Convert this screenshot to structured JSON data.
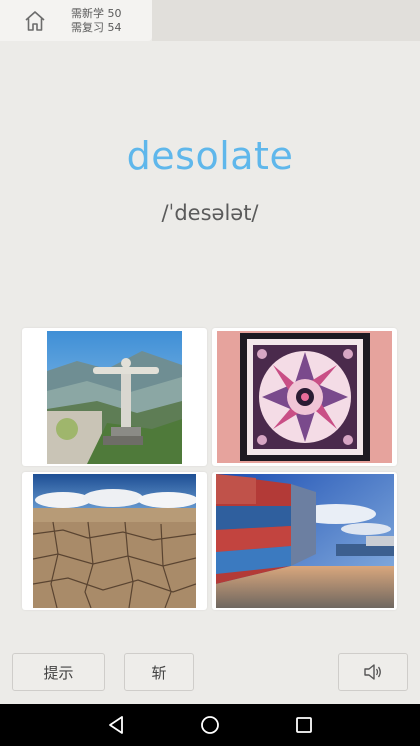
{
  "header": {
    "new_label": "需新学 50",
    "review_label": "需复习 54"
  },
  "word": {
    "text": "desolate",
    "phonetic": "/ˈdesələt/"
  },
  "images": [
    {
      "name": "christ-the-redeemer-image"
    },
    {
      "name": "ornate-scarf-pattern-image"
    },
    {
      "name": "cracked-dry-land-image"
    },
    {
      "name": "shipping-containers-image"
    }
  ],
  "buttons": {
    "hint": "提示",
    "skip": "斩"
  },
  "icons": {
    "home": "home-icon",
    "sound": "speaker-icon",
    "back": "back-triangle-icon",
    "home_nav": "home-circle-icon",
    "recents": "recents-square-icon"
  },
  "colors": {
    "word": "#5fb7eb",
    "background": "#ecebe8"
  }
}
